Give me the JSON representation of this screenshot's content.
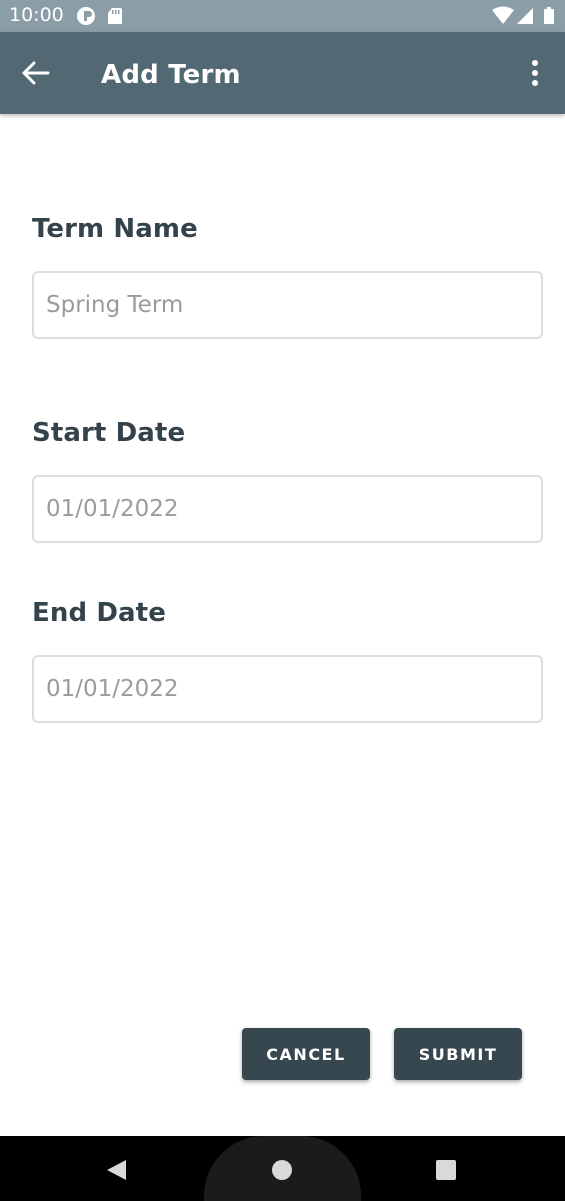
{
  "status_bar": {
    "time": "10:00"
  },
  "app_bar": {
    "title": "Add Term"
  },
  "form": {
    "term_name": {
      "label": "Term Name",
      "value": "",
      "placeholder": "Spring Term"
    },
    "start_date": {
      "label": "Start Date",
      "value": "",
      "placeholder": "01/01/2022"
    },
    "end_date": {
      "label": "End Date",
      "value": "",
      "placeholder": "01/01/2022"
    }
  },
  "actions": {
    "cancel_label": "CANCEL",
    "submit_label": "SUBMIT"
  },
  "icons": {
    "back": "arrow-back-icon",
    "overflow": "more-vert-icon",
    "nav_back": "triangle-back-icon",
    "nav_home": "circle-home-icon",
    "nav_recents": "square-recents-icon"
  },
  "colors": {
    "status_bar": "#8b9ea8",
    "app_bar": "#526872",
    "button": "#37474f",
    "label": "#34434b"
  }
}
